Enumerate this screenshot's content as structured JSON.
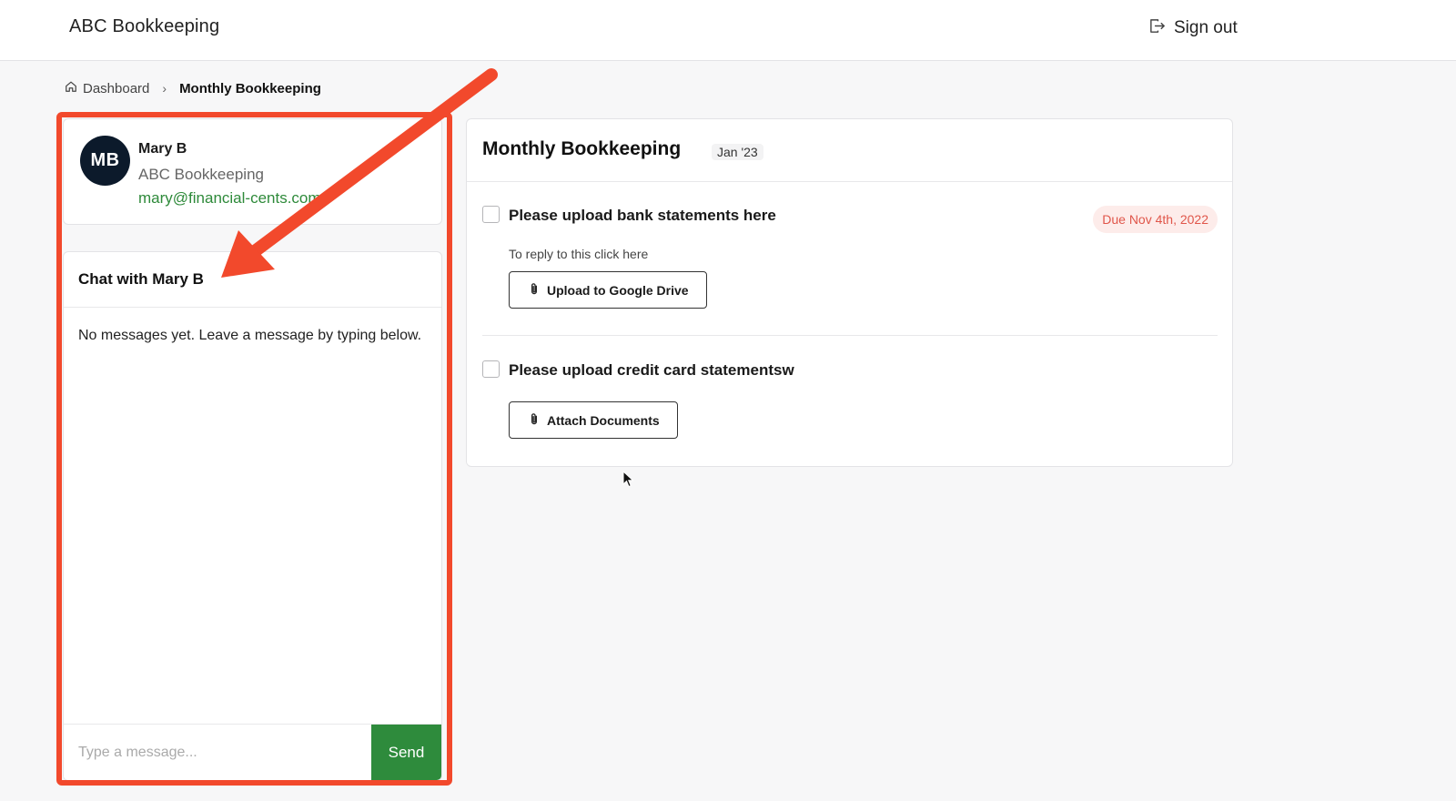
{
  "header": {
    "brand": "ABC Bookkeeping",
    "sign_out_label": "Sign out"
  },
  "breadcrumb": {
    "home_label": "Dashboard",
    "current_label": "Monthly Bookkeeping"
  },
  "contact": {
    "initials": "MB",
    "name": "Mary B",
    "company": "ABC Bookkeeping",
    "email": "mary@financial-cents.com"
  },
  "chat": {
    "title": "Chat with Mary B",
    "empty_message": "No messages yet. Leave a message by typing below.",
    "input_placeholder": "Type a message...",
    "send_label": "Send"
  },
  "tasks_panel": {
    "title": "Monthly Bookkeeping",
    "period": "Jan '23",
    "tasks": [
      {
        "label": "Please upload bank statements here",
        "due": "Due Nov 4th, 2022",
        "reply_hint": "To reply to this click here",
        "action_label": "Upload to Google Drive",
        "checked": false
      },
      {
        "label": "Please upload credit card statementsw",
        "action_label": "Attach Documents",
        "checked": false
      }
    ]
  },
  "colors": {
    "accent_green": "#2e8b3c",
    "avatar_bg": "#0c1a2b",
    "highlight": "#f2492c",
    "due_badge_bg": "#fdecea",
    "due_badge_text": "#e0564a"
  }
}
